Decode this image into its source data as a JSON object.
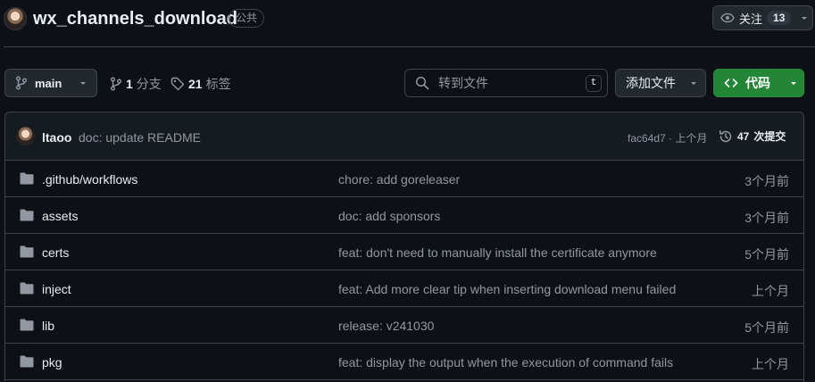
{
  "repo": {
    "name": "wx_channels_download",
    "visibility": "公共"
  },
  "watch": {
    "label": "关注",
    "count": "13"
  },
  "toolbar": {
    "branch": "main",
    "branches_count": "1",
    "branches_label": "分支",
    "tags_count": "21",
    "tags_label": "标签",
    "search_placeholder": "转到文件",
    "search_shortcut": "t",
    "add_file_label": "添加文件",
    "code_label": "代码"
  },
  "latest_commit": {
    "author": "ltaoo",
    "message": "doc: update README",
    "hash_time": "fac64d7 · 上个月",
    "commits_count": "47",
    "commits_label": "次提交"
  },
  "files": [
    {
      "name": ".github/workflows",
      "message": "chore: add goreleaser",
      "time": "3个月前"
    },
    {
      "name": "assets",
      "message": "doc: add sponsors",
      "time": "3个月前"
    },
    {
      "name": "certs",
      "message": "feat: don't need to manually install the certificate anymore",
      "time": "5个月前"
    },
    {
      "name": "inject",
      "message": "feat: Add more clear tip when inserting download menu failed",
      "time": "上个月"
    },
    {
      "name": "lib",
      "message": "release: v241030",
      "time": "5个月前"
    },
    {
      "name": "pkg",
      "message": "feat: display the output when the execution of command fails",
      "time": "上个月"
    }
  ],
  "colors": {
    "background": "#0d1117",
    "border": "#3d444d",
    "primary_button": "#238636",
    "folder_icon": "#9198a1",
    "muted_text": "#9198a1"
  }
}
